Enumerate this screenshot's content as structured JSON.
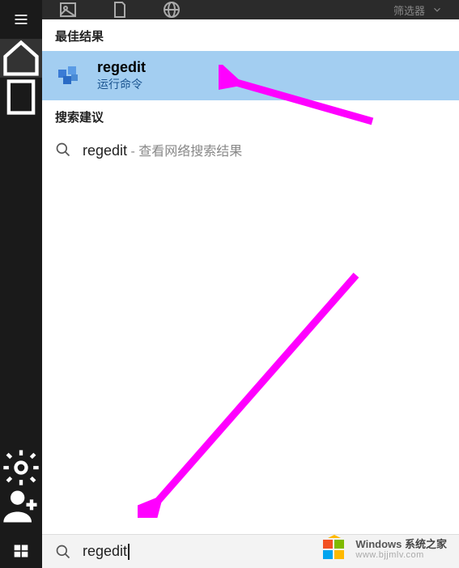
{
  "top": {
    "right_label": "筛选器"
  },
  "sections": {
    "best_header": "最佳结果",
    "suggest_header": "搜索建议"
  },
  "best_match": {
    "title": "regedit",
    "subtitle": "运行命令"
  },
  "suggestion": {
    "query": "regedit",
    "separator": " - ",
    "desc": "查看网络搜索结果"
  },
  "search": {
    "value": "regedit"
  },
  "watermark": {
    "line1a": "Windows",
    "line1b": "系统之家",
    "line2": "www.bjjmlv.com"
  }
}
